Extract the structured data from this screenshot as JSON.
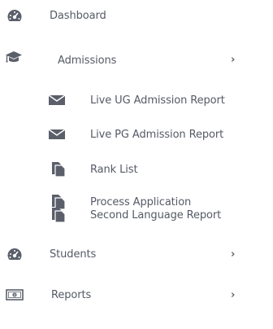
{
  "menu": {
    "dashboard": {
      "label": "Dashboard",
      "icon": "dashboard-gauge-icon"
    },
    "admissions": {
      "label": "Admissions",
      "icon": "graduation-cap-icon",
      "expanded": true,
      "chevron": "›",
      "children": [
        {
          "label": "Live UG Admission Report",
          "icon": "envelope-icon"
        },
        {
          "label": "Live PG Admission Report",
          "icon": "envelope-icon"
        },
        {
          "label": "Rank List",
          "icon": "copy-files-icon"
        },
        {
          "label": "Process Application",
          "icon": "copy-files-icon"
        },
        {
          "label": "Second Language Report",
          "icon": "copy-files-icon"
        }
      ]
    },
    "students": {
      "label": "Students",
      "icon": "dashboard-gauge-icon",
      "chevron": "›"
    },
    "reports": {
      "label": "Reports",
      "icon": "money-bill-icon",
      "chevron": "›"
    }
  },
  "colors": {
    "text": "#555a64",
    "icon": "#5a5f6a"
  }
}
